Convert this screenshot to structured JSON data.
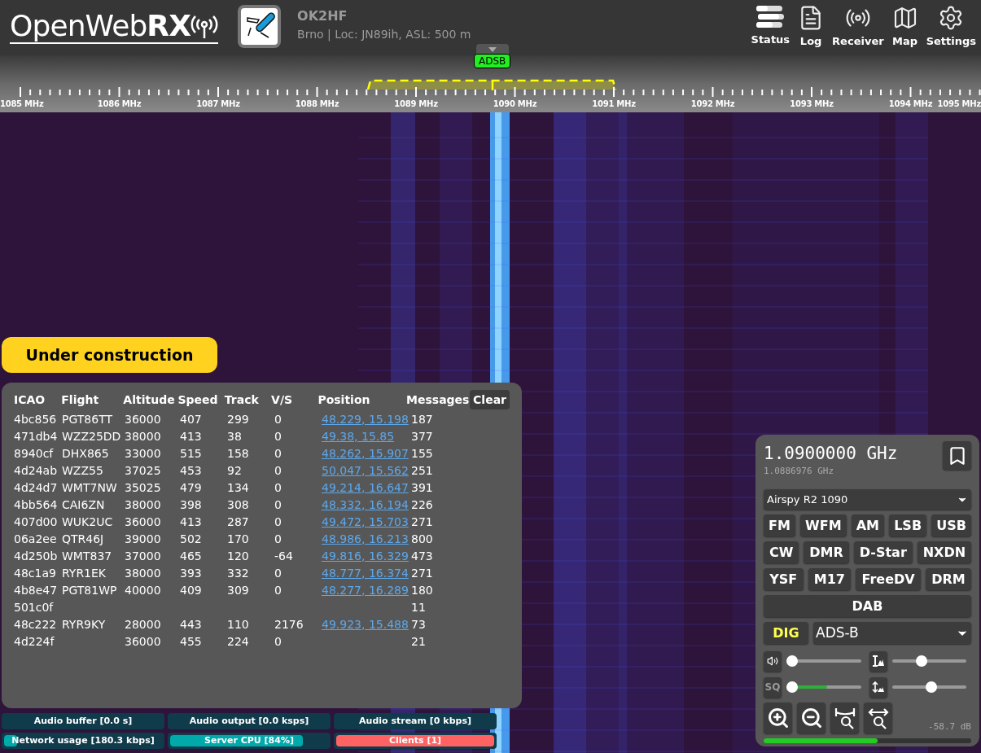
{
  "logo": "OpenWeb**RX**",
  "receiver": {
    "callsign": "OK2HF",
    "location": "Brno | Loc: JN89ih, ASL: 500 m"
  },
  "nav": [
    {
      "kind": "status",
      "label": "Status"
    },
    {
      "kind": "log",
      "label": "Log"
    },
    {
      "kind": "receiver",
      "label": "Receiver"
    },
    {
      "kind": "map",
      "label": "Map"
    },
    {
      "kind": "settings",
      "label": "Settings"
    }
  ],
  "scale": {
    "marker": "ADSB",
    "labels": [
      "1085 MHz",
      "1086 MHz",
      "1087 MHz",
      "1088 MHz",
      "1089 MHz",
      "1090 MHz",
      "1091 MHz",
      "1092 MHz",
      "1093 MHz",
      "1094 MHz",
      "1095 MHz"
    ]
  },
  "banner": "Under construction",
  "table": {
    "columns": [
      "ICAO",
      "Flight",
      "Altitude",
      "Speed",
      "Track",
      "V/S",
      "Position",
      "Messages"
    ],
    "clear_button": "Clear",
    "rows": [
      {
        "icao": "4bc856",
        "flight": "PGT86TT",
        "altitude": "36000",
        "speed": "407",
        "track": "299",
        "vs": "0",
        "position": "48.229, 15.198",
        "messages": "187"
      },
      {
        "icao": "471db4",
        "flight": "WZZ25DD",
        "altitude": "38000",
        "speed": "413",
        "track": "38",
        "vs": "0",
        "position": "49.38, 15.85",
        "messages": "377"
      },
      {
        "icao": "8940cf",
        "flight": "DHX865",
        "altitude": "33000",
        "speed": "515",
        "track": "158",
        "vs": "0",
        "position": "48.262, 15.907",
        "messages": "155"
      },
      {
        "icao": "4d24ab",
        "flight": "WZZ55",
        "altitude": "37025",
        "speed": "453",
        "track": "92",
        "vs": "0",
        "position": "50.047, 15.562",
        "messages": "251"
      },
      {
        "icao": "4d24d7",
        "flight": "WMT7NW",
        "altitude": "35025",
        "speed": "479",
        "track": "134",
        "vs": "0",
        "position": "49.214, 16.647",
        "messages": "391"
      },
      {
        "icao": "4bb564",
        "flight": "CAI6ZN",
        "altitude": "38000",
        "speed": "398",
        "track": "308",
        "vs": "0",
        "position": "48.332, 16.194",
        "messages": "226"
      },
      {
        "icao": "407d00",
        "flight": "WUK2UC",
        "altitude": "36000",
        "speed": "413",
        "track": "287",
        "vs": "0",
        "position": "49.472, 15.703",
        "messages": "271"
      },
      {
        "icao": "06a2ee",
        "flight": "QTR46J",
        "altitude": "39000",
        "speed": "502",
        "track": "170",
        "vs": "0",
        "position": "48.986, 16.213",
        "messages": "800"
      },
      {
        "icao": "4d250b",
        "flight": "WMT837",
        "altitude": "37000",
        "speed": "465",
        "track": "120",
        "vs": "-64",
        "position": "49.816, 16.329",
        "messages": "473"
      },
      {
        "icao": "48c1a9",
        "flight": "RYR1EK",
        "altitude": "38000",
        "speed": "393",
        "track": "332",
        "vs": "0",
        "position": "48.777, 16.374",
        "messages": "271"
      },
      {
        "icao": "4b8e47",
        "flight": "PGT81WP",
        "altitude": "40000",
        "speed": "409",
        "track": "309",
        "vs": "0",
        "position": "48.277, 16.289",
        "messages": "180"
      },
      {
        "icao": "501c0f",
        "messages": "11"
      },
      {
        "icao": "48c222",
        "flight": "RYR9KY",
        "altitude": "28000",
        "speed": "443",
        "track": "110",
        "vs": "2176",
        "position": "49.923, 15.488",
        "messages": "73"
      },
      {
        "icao": "4d224f",
        "altitude": "36000",
        "speed": "455",
        "track": "224",
        "vs": "0",
        "messages": "21"
      }
    ]
  },
  "status_bars": [
    {
      "label": "Audio buffer [0.0 s]"
    },
    {
      "label": "Audio output [0.0 ksps]"
    },
    {
      "label": "Audio stream [0 kbps]"
    },
    {
      "label": "Network usage [180.3 kbps]",
      "level": 0.08,
      "color": "#00aaaa"
    },
    {
      "label": "Server CPU [84%]",
      "level": 0.84,
      "color": "#00aaaa"
    },
    {
      "label": "Clients [1]",
      "level": 1,
      "color": "#ff6262"
    }
  ],
  "panel": {
    "frequency": "1.0900000 GHz",
    "offset_frequency": "1.0886976 GHz",
    "profile": "Airspy R2 1090",
    "mode_rows": [
      [
        {
          "label": "FM",
          "selected": false
        },
        {
          "label": "WFM",
          "selected": false
        },
        {
          "label": "AM",
          "selected": false
        },
        {
          "label": "LSB",
          "selected": false
        },
        {
          "label": "USB",
          "selected": false
        }
      ],
      [
        {
          "label": "CW",
          "selected": false
        },
        {
          "label": "DMR",
          "selected": false
        },
        {
          "label": "D-Star",
          "selected": false
        },
        {
          "label": "NXDN",
          "selected": false
        }
      ],
      [
        {
          "label": "YSF",
          "selected": false
        },
        {
          "label": "M17",
          "selected": false
        },
        {
          "label": "FreeDV",
          "selected": false
        },
        {
          "label": "DRM",
          "selected": false
        }
      ],
      [
        {
          "label": "DAB",
          "selected": false
        }
      ]
    ],
    "dig": {
      "label": "DIG",
      "selected": true
    },
    "digital_mode": "ADS-B",
    "volume": {
      "level": 0
    },
    "squelch": {
      "label": "SQ",
      "level": 0,
      "signal": {
        "level": 0.55
      }
    },
    "waterfall_max": {
      "level": 0.38
    },
    "waterfall_min": {
      "level": 0.54
    },
    "smeter": {
      "reading": "-58.7 dB",
      "level": 0.55
    }
  }
}
